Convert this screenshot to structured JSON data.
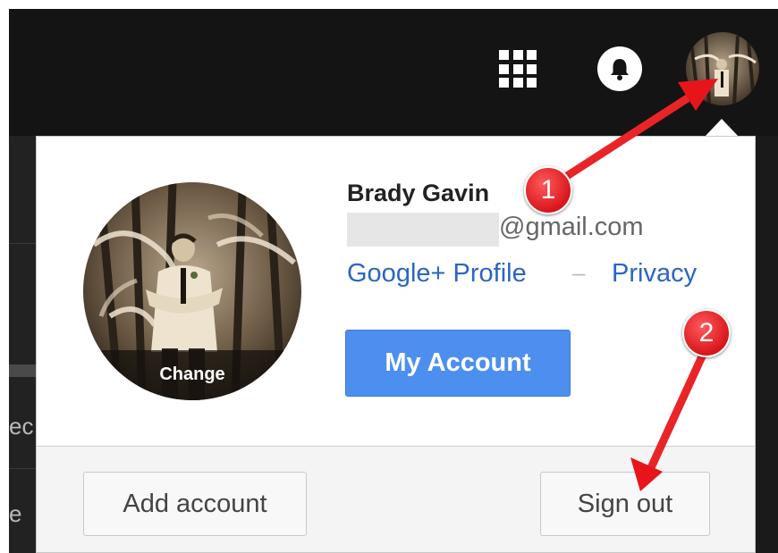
{
  "header": {
    "apps_icon": "apps-grid-icon",
    "notifications_icon": "bell-icon"
  },
  "account": {
    "name": "Brady Gavin",
    "email_domain": "@gmail.com",
    "avatar_change_label": "Change",
    "profile_link": "Google+ Profile",
    "link_separator": "–",
    "privacy_link": "Privacy",
    "my_account_button": "My Account"
  },
  "footer": {
    "add_account_button": "Add account",
    "sign_out_button": "Sign out"
  },
  "background": {
    "left_text_1": "ec",
    "left_text_2": "e "
  },
  "annotations": {
    "badge_1": "1",
    "badge_2": "2",
    "color": "#e8141c"
  },
  "colors": {
    "link": "#2a66c2",
    "primary_button": "#4d8fee",
    "topbar": "#141414"
  }
}
